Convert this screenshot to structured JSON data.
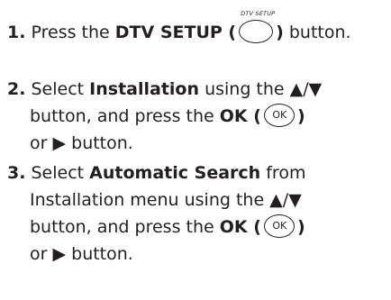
{
  "steps": [
    {
      "number": "1.",
      "text_before": "Press the",
      "bold_label": "DTV SETUP (",
      "button_caption": "DTV SETUP",
      "bold_close": ")",
      "text_after": "button."
    },
    {
      "number": "2.",
      "text_select": "Select",
      "bold_item": "Installation",
      "text_using": "using the ▲/▼",
      "line2_before": "button, and press the",
      "bold_ok": "OK (",
      "ok_label": "OK",
      "bold_close": ")",
      "line3": "or ▶ button."
    },
    {
      "number": "3.",
      "text_select": "Select",
      "bold_item": "Automatic Search",
      "text_from": "from",
      "line2": "Installation menu using the ▲/▼",
      "line3_before": "button, and press the",
      "bold_ok": "OK (",
      "ok_label": "OK",
      "bold_close": ")",
      "line4": "or ▶ button."
    }
  ]
}
